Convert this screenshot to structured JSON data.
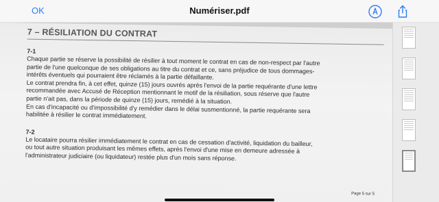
{
  "nav": {
    "done_label": "OK",
    "title": "Numériser.pdf",
    "markup_icon": "markup-pen-icon",
    "share_icon": "share-icon"
  },
  "document": {
    "section_title": "7 – RÉSILIATION DU CONTRAT",
    "clauses": [
      {
        "number": "7-1",
        "lines": [
          "Chaque partie se réserve la possibilité de résilier à tout moment le contrat en cas de non-respect par l'autre",
          "partie de l'une quelconque de ses obligations au titre du contrat et ce, sans préjudice de tous dommages-",
          "intérêts éventuels qui pourraient être réclamés à la partie défaillante.",
          "Le contrat prendra fin, à cet effet, quinze (15) jours ouvrés après l'envoi de la partie requérante d'une lettre",
          "recommandée avec Accusé de Réception mentionnant le motif de la résiliation, sous réserve que l'autre",
          "partie n'ait pas, dans la période de quinze (15) jours, remédié à la situation.",
          "En cas d'incapacité ou d'impossibilité d'y remédier dans le délai susmentionné, la partie requérante sera",
          "habilitée à résilier le contrat immédiatement."
        ]
      },
      {
        "number": "7-2",
        "lines": [
          "Le locataire pourra résilier immédiatement le contrat en cas de cessation d'activité, liquidation du bailleur,",
          "ou tout autre situation produisant les mêmes effets, après l'envoi d'une mise en demeure adressée à",
          "l'administrateur judiciaire (ou liquidateur) restée plus d'un mois sans réponse."
        ]
      }
    ],
    "page_label": "Page 5 sur 5"
  },
  "thumbnails": {
    "count": 5,
    "active_index": 4
  },
  "colors": {
    "accent": "#2f7cf6",
    "nav_bg": "#f7f7f8",
    "page_bg": "#efefef"
  }
}
